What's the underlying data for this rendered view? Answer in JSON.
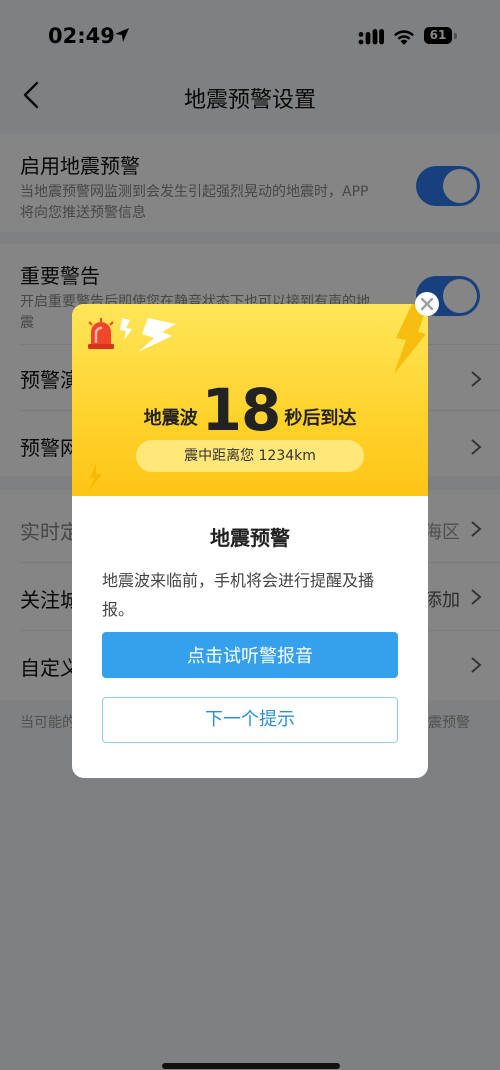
{
  "status_bar": {
    "time": "02:49",
    "battery": "61"
  },
  "nav": {
    "title": "地震预警设置"
  },
  "settings": {
    "enable": {
      "title": "启用地震预警",
      "desc": "当地震预警网监测到会发生引起强烈晃动的地震时，APP 将向您推送预警信息"
    },
    "important": {
      "title": "重要警告",
      "desc": "开启重要警告后即使您在静音状态下也可以接到有声的地震"
    },
    "row3": {
      "title": "预警演"
    },
    "row4": {
      "title": "预警网"
    },
    "realtime": {
      "title": "实时定",
      "value": "海区"
    },
    "follow": {
      "title": "关注城",
      "value": "添加"
    },
    "custom": {
      "title": "自定义"
    },
    "footer_left": "当可能的",
    "footer_right": "震预警"
  },
  "modal": {
    "count_prefix": "地震波",
    "count_number": "18",
    "count_suffix": "秒后到达",
    "distance": "震中距离您 1234km",
    "title": "地震预警",
    "body": "地震波来临前，手机将会进行提醒及播报。",
    "primary_button": "点击试听警报音",
    "secondary_button": "下一个提示"
  },
  "colors": {
    "accent": "#2d7cf0",
    "button": "#35a1ec",
    "banner": "#ffd22b"
  }
}
